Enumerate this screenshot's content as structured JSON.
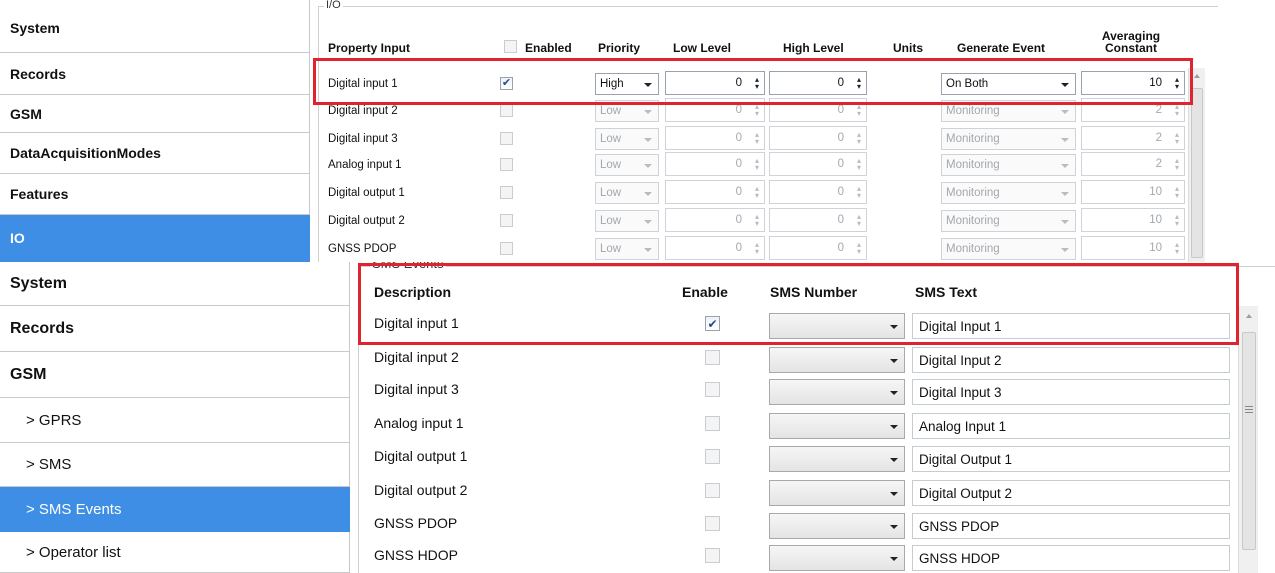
{
  "top": {
    "group_title": "I/O",
    "nav": [
      {
        "label": "System",
        "selected": false
      },
      {
        "label": "Records",
        "selected": false
      },
      {
        "label": "GSM",
        "selected": false
      },
      {
        "label": "DataAcquisitionModes",
        "selected": false
      },
      {
        "label": "Features",
        "selected": false
      },
      {
        "label": "IO",
        "selected": true
      }
    ],
    "headers": {
      "property_input": "Property Input",
      "enabled": "Enabled",
      "priority": "Priority",
      "low_level": "Low Level",
      "high_level": "High Level",
      "units": "Units",
      "generate_event": "Generate Event",
      "averaging_constant": "Averaging Constant"
    },
    "rows": [
      {
        "name": "Digital input 1",
        "enabled": true,
        "priority": "High",
        "low": "0",
        "high": "0",
        "event": "On Both",
        "avg": "10",
        "active": true
      },
      {
        "name": "Digital input 2",
        "enabled": false,
        "priority": "Low",
        "low": "0",
        "high": "0",
        "event": "Monitoring",
        "avg": "2",
        "active": false
      },
      {
        "name": "Digital input 3",
        "enabled": false,
        "priority": "Low",
        "low": "0",
        "high": "0",
        "event": "Monitoring",
        "avg": "2",
        "active": false
      },
      {
        "name": "Analog input 1",
        "enabled": false,
        "priority": "Low",
        "low": "0",
        "high": "0",
        "event": "Monitoring",
        "avg": "2",
        "active": false
      },
      {
        "name": "Digital output 1",
        "enabled": false,
        "priority": "Low",
        "low": "0",
        "high": "0",
        "event": "Monitoring",
        "avg": "10",
        "active": false
      },
      {
        "name": "Digital output 2",
        "enabled": false,
        "priority": "Low",
        "low": "0",
        "high": "0",
        "event": "Monitoring",
        "avg": "10",
        "active": false
      },
      {
        "name": "GNSS PDOP",
        "enabled": false,
        "priority": "Low",
        "low": "0",
        "high": "0",
        "event": "Monitoring",
        "avg": "10",
        "active": false
      }
    ]
  },
  "bottom": {
    "group_title": "SMS Events",
    "nav": [
      {
        "label": "System",
        "selected": false,
        "sub": false
      },
      {
        "label": "Records",
        "selected": false,
        "sub": false
      },
      {
        "label": "GSM",
        "selected": false,
        "sub": false
      },
      {
        "label": "> GPRS",
        "selected": false,
        "sub": true
      },
      {
        "label": "> SMS",
        "selected": false,
        "sub": true
      },
      {
        "label": "> SMS Events",
        "selected": true,
        "sub": true
      },
      {
        "label": "> Operator list",
        "selected": false,
        "sub": true
      }
    ],
    "headers": {
      "description": "Description",
      "enable": "Enable",
      "sms_number": "SMS Number",
      "sms_text": "SMS Text"
    },
    "rows": [
      {
        "desc": "Digital input 1",
        "enabled": true,
        "number": "",
        "text": "Digital Input 1"
      },
      {
        "desc": "Digital input 2",
        "enabled": false,
        "number": "",
        "text": "Digital Input 2"
      },
      {
        "desc": "Digital input 3",
        "enabled": false,
        "number": "",
        "text": "Digital Input 3"
      },
      {
        "desc": "Analog input 1",
        "enabled": false,
        "number": "",
        "text": "Analog Input 1"
      },
      {
        "desc": "Digital output 1",
        "enabled": false,
        "number": "",
        "text": "Digital Output 1"
      },
      {
        "desc": "Digital output 2",
        "enabled": false,
        "number": "",
        "text": "Digital Output 2"
      },
      {
        "desc": "GNSS PDOP",
        "enabled": false,
        "number": "",
        "text": "GNSS PDOP"
      },
      {
        "desc": "GNSS HDOP",
        "enabled": false,
        "number": "",
        "text": "GNSS HDOP"
      }
    ]
  },
  "colors": {
    "selected": "#3d8ee4",
    "highlight": "#e0242f"
  },
  "icons": {
    "check": "checkmark-icon",
    "spin": "spin-updown-icon",
    "dropdown": "chevron-down-icon"
  }
}
